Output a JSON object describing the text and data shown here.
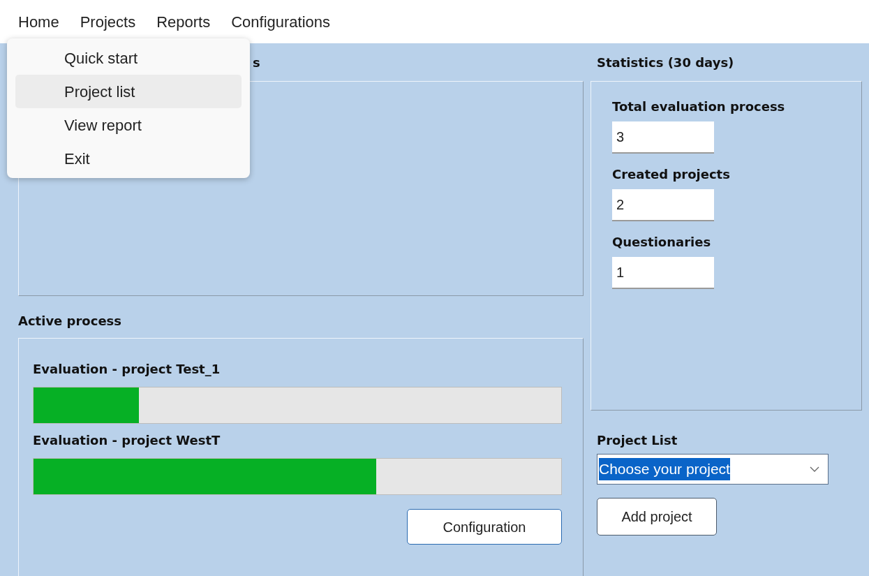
{
  "menu_bar": [
    {
      "label": "Home"
    },
    {
      "label": "Projects"
    },
    {
      "label": "Reports"
    },
    {
      "label": "Configurations"
    }
  ],
  "open_menu": {
    "items": [
      {
        "label": "Quick start",
        "selected": false
      },
      {
        "label": "Project list",
        "selected": true
      },
      {
        "label": "View report",
        "selected": false
      },
      {
        "label": "Exit",
        "selected": false
      }
    ]
  },
  "top_section": {
    "title": "s"
  },
  "active_process": {
    "title": "Active process",
    "processes": [
      {
        "label": "Evaluation - project Test_1",
        "level": 0.2
      },
      {
        "label": "Evaluation - project WestT",
        "level": 0.65
      }
    ],
    "button": "Configuration"
  },
  "statistics": {
    "title": "Statistics (30 days)",
    "fields": [
      {
        "label": "Total evaluation process",
        "value": "3"
      },
      {
        "label": "Created projects",
        "value": "2"
      },
      {
        "label": "Questionaries",
        "value": "1"
      }
    ]
  },
  "project_list": {
    "title": "Project List",
    "value": "Choose your project",
    "text_selected": true,
    "button": "Add project"
  }
}
